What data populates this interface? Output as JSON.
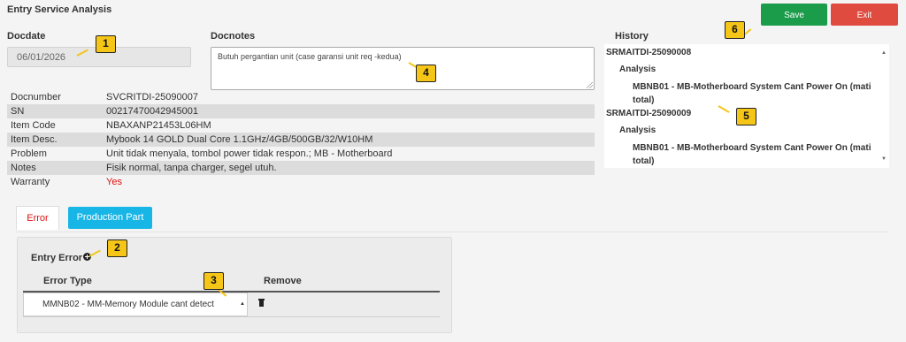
{
  "page": {
    "title": "Entry Service Analysis"
  },
  "actions": {
    "save_label": "Save",
    "exit_label": "Exit",
    "save_color": "#1a9c4a",
    "exit_color": "#e04b3f"
  },
  "docdate": {
    "label": "Docdate",
    "value": "06/01/2026"
  },
  "docnotes": {
    "label": "Docnotes",
    "value": "Butuh pergantian unit (case garansi unit req -kedua)"
  },
  "info": [
    {
      "label": "Docnumber",
      "value": "SVCRITDI-25090007"
    },
    {
      "label": "SN",
      "value": "00217470042945001"
    },
    {
      "label": "Item Code",
      "value": "NBAXANP21453L06HM"
    },
    {
      "label": "Item Desc.",
      "value": "Mybook 14 GOLD Dual Core 1.1GHz/4GB/500GB/32/W10HM"
    },
    {
      "label": "Problem",
      "value": "Unit tidak menyala, tombol power tidak respon.; MB - Motherboard"
    },
    {
      "label": "Notes",
      "value": "Fisik normal, tanpa charger, segel utuh."
    },
    {
      "label": "Warranty",
      "value": "Yes"
    }
  ],
  "history": {
    "label": "History",
    "entries": [
      {
        "doc": "SRMAITDI-25090008",
        "analysis_label": "Analysis",
        "item": "MBNB01 - MB-Motherboard System Cant Power On (mati total)"
      },
      {
        "doc": "SRMAITDI-25090009",
        "analysis_label": "Analysis",
        "item": "MBNB01 - MB-Motherboard System Cant Power On (mati total)"
      }
    ]
  },
  "tabs": [
    {
      "label": "Error",
      "active": true,
      "color": "#e01010"
    },
    {
      "label": "Production Part",
      "active": false,
      "color": "#17b6e6"
    }
  ],
  "error_panel": {
    "entry_label": "Entry Error",
    "columns": [
      "Error Type",
      "Remove"
    ],
    "rows": [
      {
        "error_type": "MMNB02 - MM-Memory Module cant detect"
      }
    ]
  },
  "markers": [
    "1",
    "2",
    "3",
    "4",
    "5",
    "6"
  ],
  "marker_color": "#f5c518"
}
